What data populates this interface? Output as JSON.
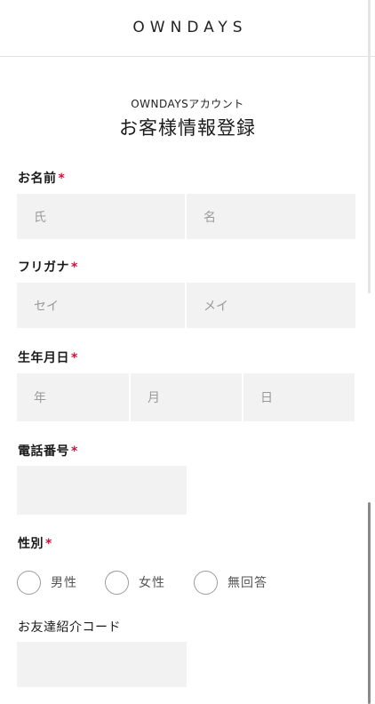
{
  "header": {
    "logo": "OWNDAYS"
  },
  "page": {
    "subtitle": "OWNDAYSアカウント",
    "title": "お客様情報登録"
  },
  "name_section": {
    "label": "お名前",
    "required_mark": "*",
    "last_placeholder": "氏",
    "first_placeholder": "名"
  },
  "kana_section": {
    "label": "フリガナ",
    "required_mark": "*",
    "last_placeholder": "セイ",
    "first_placeholder": "メイ"
  },
  "birth_section": {
    "label": "生年月日",
    "required_mark": "*",
    "year_placeholder": "年",
    "month_placeholder": "月",
    "day_placeholder": "日"
  },
  "phone_section": {
    "label": "電話番号",
    "required_mark": "*",
    "value": ""
  },
  "gender_section": {
    "label": "性別",
    "required_mark": "*",
    "options": [
      "男性",
      "女性",
      "無回答"
    ]
  },
  "referral_section": {
    "label": "お友達紹介コード",
    "value": ""
  }
}
